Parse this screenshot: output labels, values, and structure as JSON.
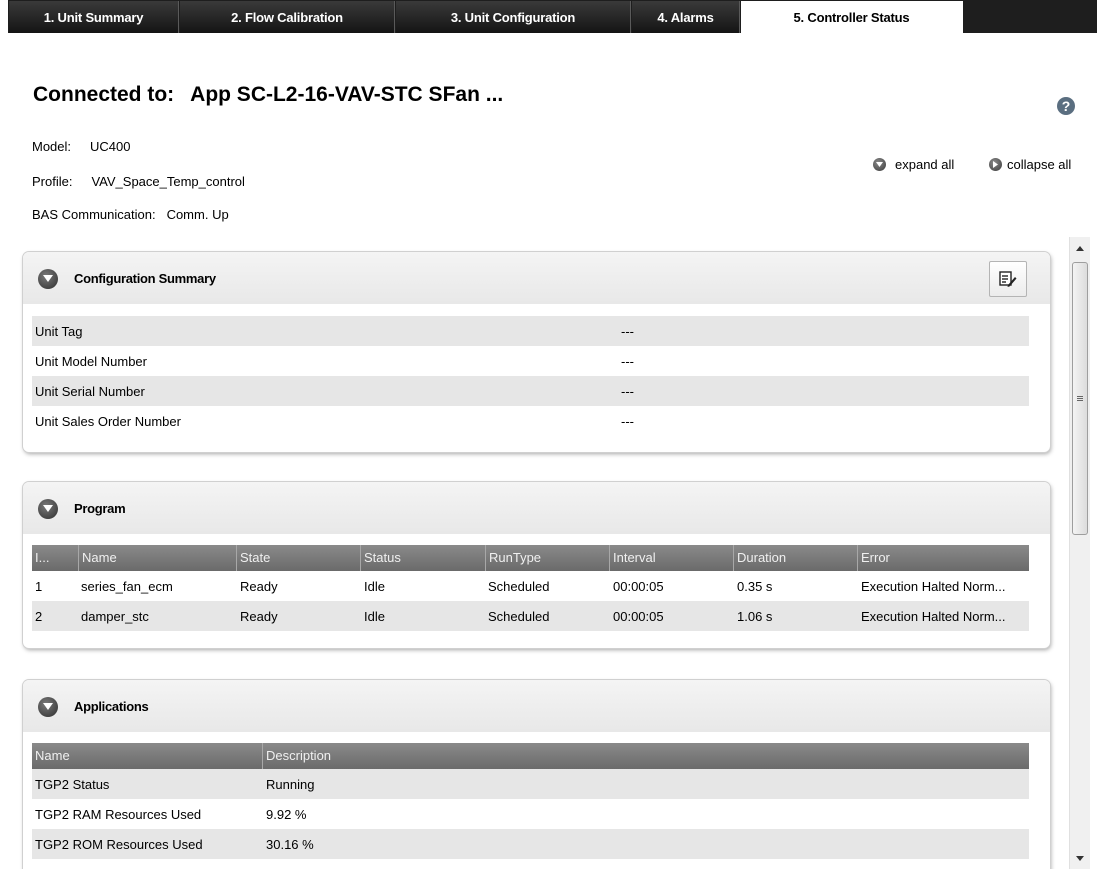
{
  "tabs": [
    {
      "label": "1. Unit Summary",
      "active": false
    },
    {
      "label": "2. Flow Calibration",
      "active": false
    },
    {
      "label": "3. Unit Configuration",
      "active": false
    },
    {
      "label": "4. Alarms",
      "active": false
    },
    {
      "label": "5. Controller Status",
      "active": true
    }
  ],
  "header": {
    "connected_label": "Connected to:",
    "connected_value": "App SC-L2-16-VAV-STC SFan ...",
    "help_glyph": "?"
  },
  "info": {
    "model_label": "Model:",
    "model_value": "UC400",
    "profile_label": "Profile:",
    "profile_value": "VAV_Space_Temp_control",
    "bas_label": "BAS Communication:",
    "bas_value": "Comm. Up"
  },
  "controls": {
    "expand_all": "expand all",
    "collapse_all": "collapse all"
  },
  "config_summary": {
    "title": "Configuration Summary",
    "rows": [
      {
        "label": "Unit Tag",
        "value": "---"
      },
      {
        "label": "Unit Model Number",
        "value": "---"
      },
      {
        "label": "Unit Serial Number",
        "value": "---"
      },
      {
        "label": "Unit Sales Order Number",
        "value": "---"
      }
    ]
  },
  "program": {
    "title": "Program",
    "columns": [
      "I...",
      "Name",
      "State",
      "Status",
      "RunType",
      "Interval",
      "Duration",
      "Error"
    ],
    "rows": [
      [
        "1",
        "series_fan_ecm",
        "Ready",
        "Idle",
        "Scheduled",
        "00:00:05",
        "0.35 s",
        "Execution Halted Norm..."
      ],
      [
        "2",
        "damper_stc",
        "Ready",
        "Idle",
        "Scheduled",
        "00:00:05",
        "1.06 s",
        "Execution Halted Norm..."
      ]
    ]
  },
  "applications": {
    "title": "Applications",
    "columns": [
      "Name",
      "Description"
    ],
    "rows": [
      [
        "TGP2 Status",
        "Running"
      ],
      [
        "TGP2 RAM Resources Used",
        "9.92 %"
      ],
      [
        "TGP2 ROM Resources Used",
        "30.16 %"
      ]
    ]
  },
  "icons": {
    "collapse": "chevron-down-icon",
    "edit": "edit-document-icon",
    "help": "help-icon",
    "scroll_up": "scroll-up-arrow-icon",
    "scroll_down": "scroll-down-arrow-icon"
  }
}
